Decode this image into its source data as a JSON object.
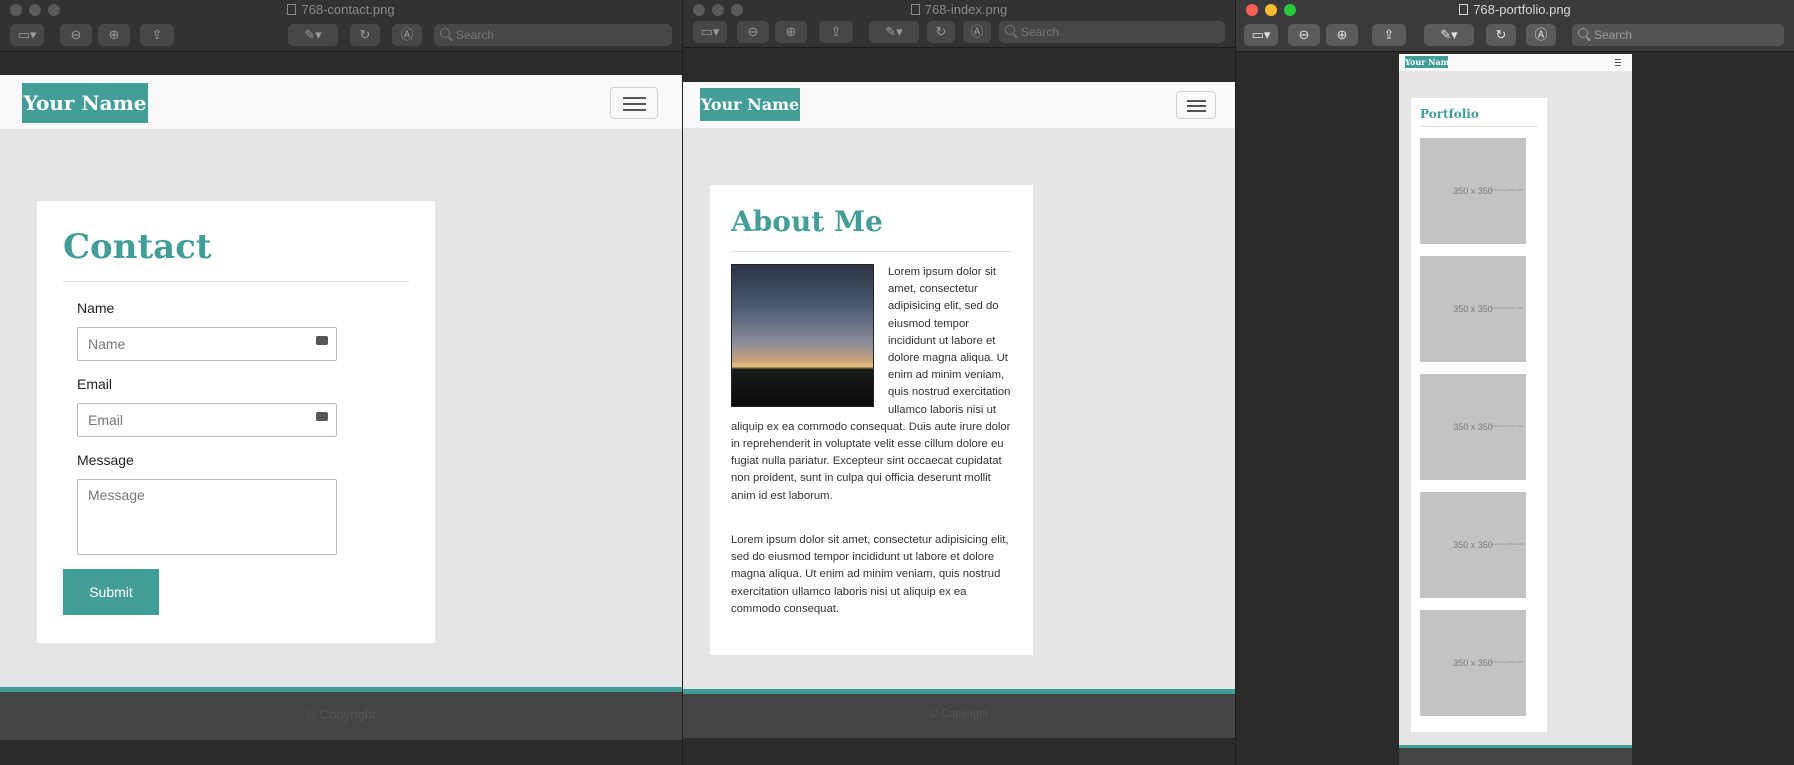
{
  "windows": [
    {
      "title": "768-contact.png",
      "search_placeholder": "Search",
      "brand": "Your Name",
      "heading": "Contact",
      "form": {
        "name_label": "Name",
        "name_placeholder": "Name",
        "email_label": "Email",
        "email_placeholder": "Email",
        "message_label": "Message",
        "message_placeholder": "Message",
        "submit_label": "Submit"
      },
      "footer": "© Copyright"
    },
    {
      "title": "768-index.png",
      "search_placeholder": "Search",
      "brand": "Your Name",
      "heading": "About Me",
      "paragraph1": "Lorem ipsum dolor sit amet, consectetur adipisicing elit, sed do eiusmod tempor incididunt ut labore et dolore magna aliqua. Ut enim ad minim veniam, quis nostrud exercitation ullamco laboris nisi ut aliquip ex ea commodo consequat. Duis aute irure dolor in reprehenderit in voluptate velit esse cillum dolore eu fugiat nulla pariatur. Excepteur sint occaecat cupidatat non proident, sunt in culpa qui officia deserunt mollit anim id est laborum.",
      "paragraph2": "Lorem ipsum dolor sit amet, consectetur adipisicing elit, sed do eiusmod tempor incididunt ut labore et dolore magna aliqua. Ut enim ad minim veniam, quis nostrud exercitation ullamco laboris nisi ut aliquip ex ea commodo consequat.",
      "footer": "© Copyright"
    },
    {
      "title": "768-portfolio.png",
      "search_placeholder": "Search",
      "brand": "Your Name",
      "heading": "Portfolio",
      "placeholders": [
        "350 x 350",
        "350 x 350",
        "350 x 350",
        "350 x 350",
        "350 x 350"
      ],
      "placeholder_credit": "Powered by HTML.COM"
    }
  ],
  "colors": {
    "accent": "#449e98",
    "page_bg": "#e5e5e5",
    "toolbar_bg": "#323232",
    "close": "#fe5f57",
    "minimize": "#febc2e",
    "zoom": "#28c840"
  },
  "icons": [
    "sidebar-icon",
    "zoom-out-icon",
    "zoom-in-icon",
    "share-icon",
    "markup-icon",
    "rotate-icon",
    "annotate-icon",
    "search-icon",
    "hamburger-icon"
  ]
}
